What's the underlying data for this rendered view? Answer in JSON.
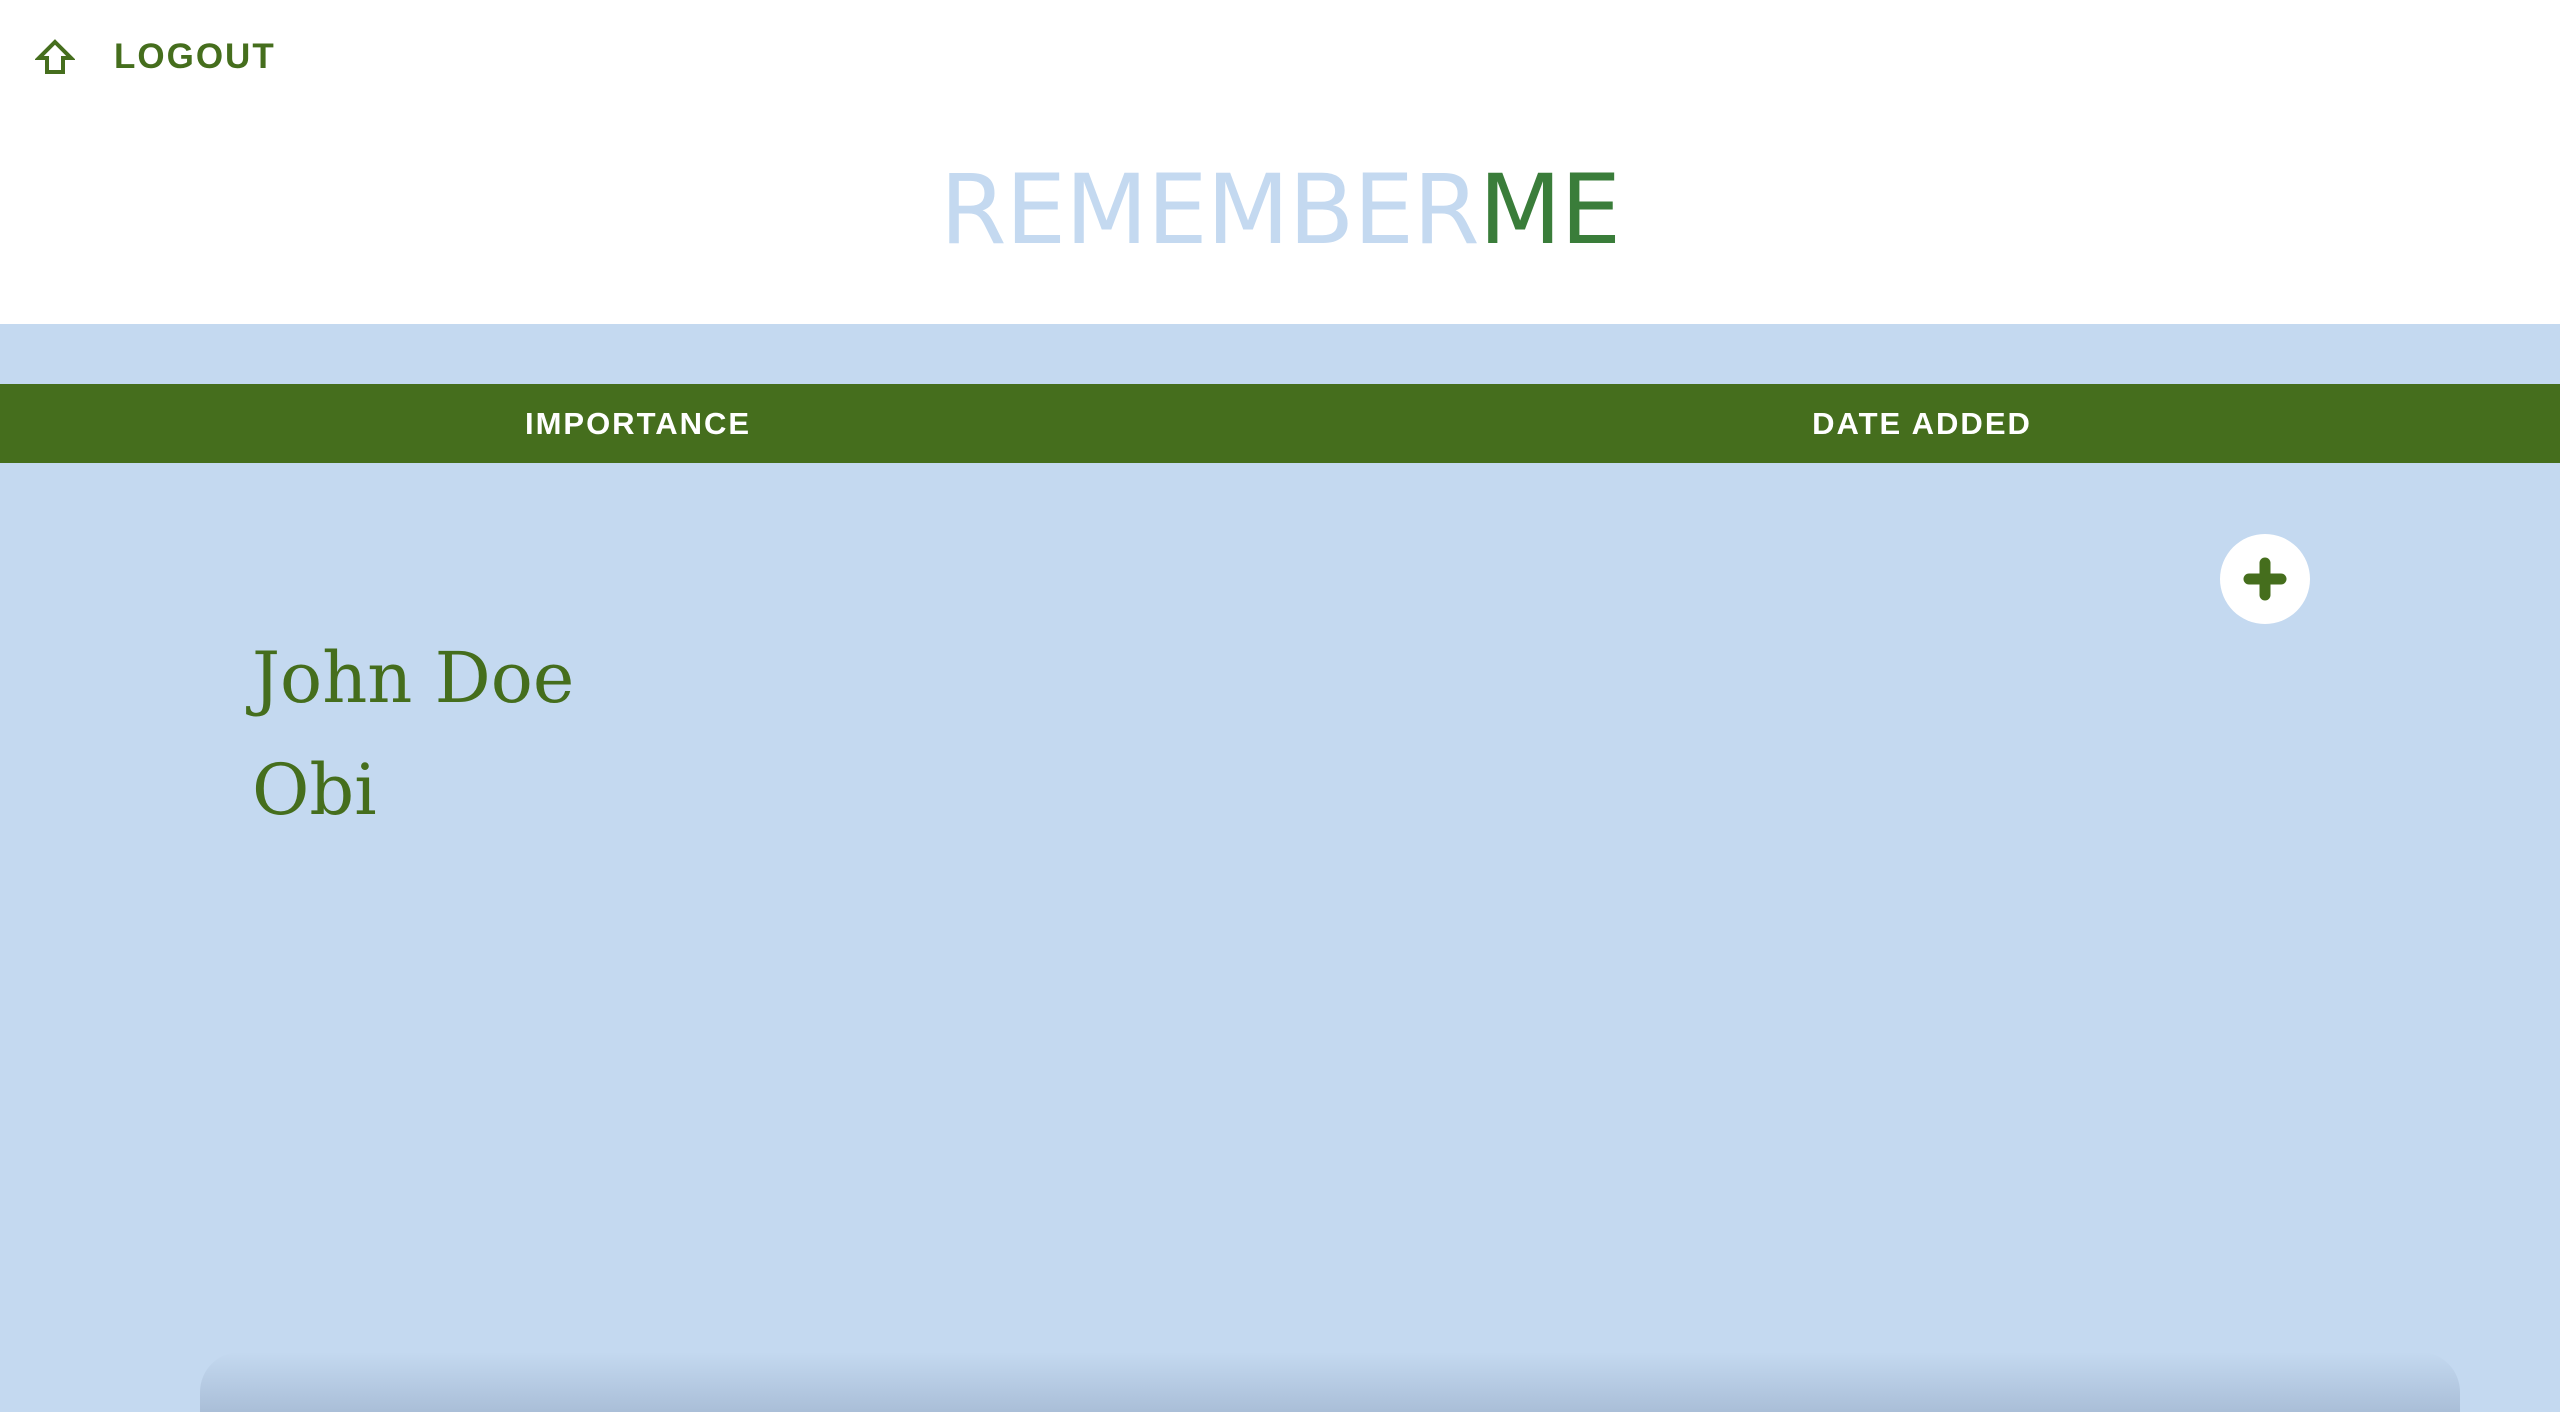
{
  "nav": {
    "home_icon": "home-icon",
    "logout_label": "LOGOUT"
  },
  "brand": {
    "part1": "REMEMBER",
    "part2": "ME"
  },
  "sort": {
    "importance_label": "IMPORTANCE",
    "date_added_label": "DATE ADDED"
  },
  "add_button": {
    "icon": "plus-icon"
  },
  "people": [
    {
      "name": "John Doe"
    },
    {
      "name": "Obi"
    }
  ],
  "colors": {
    "primary_green": "#456e1d",
    "brand_green": "#3a7d3a",
    "light_blue": "#c4d9f0",
    "white": "#ffffff"
  }
}
